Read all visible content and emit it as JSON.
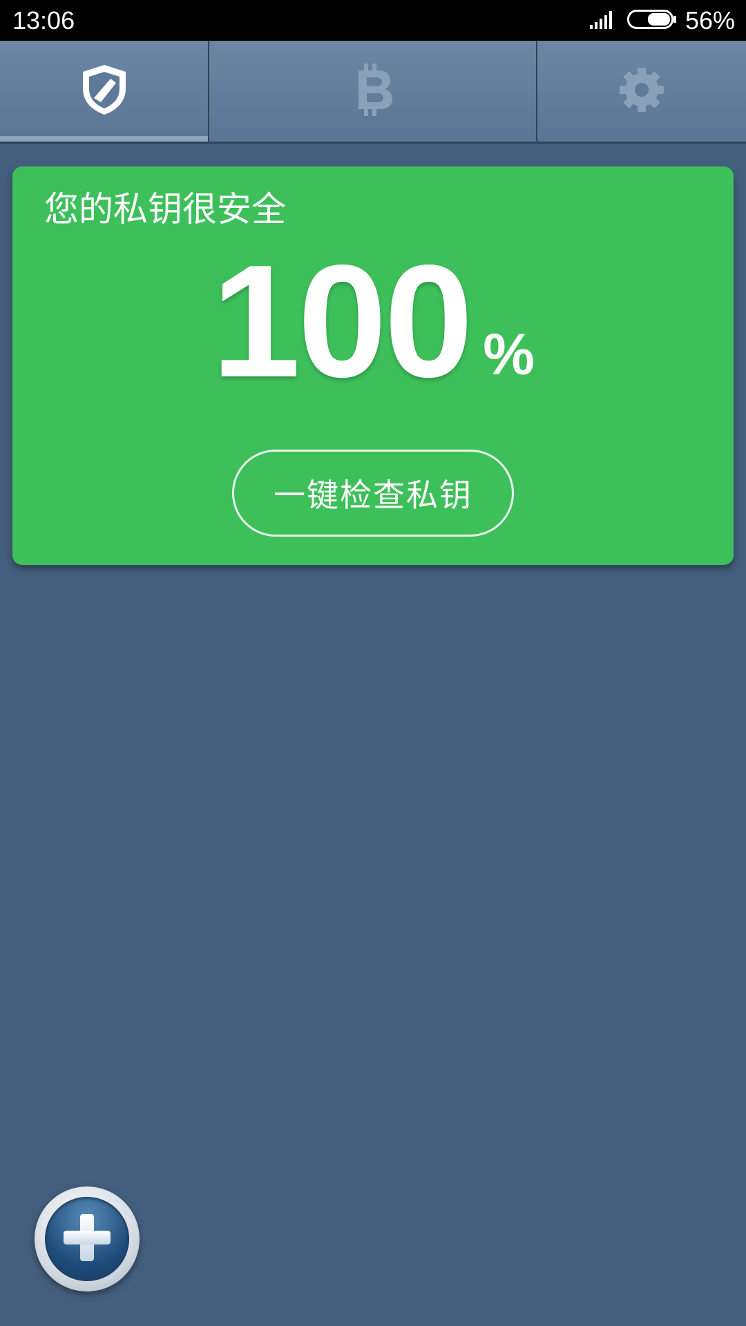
{
  "status_bar": {
    "time": "13:06",
    "battery_percent": "56%",
    "icons": [
      "signal-icon",
      "battery-icon"
    ]
  },
  "tabs": [
    {
      "name": "security",
      "icon": "shield-icon",
      "selected": true
    },
    {
      "name": "wallet",
      "icon": "bitcoin-icon",
      "selected": false
    },
    {
      "name": "settings",
      "icon": "gear-icon",
      "selected": false
    }
  ],
  "security_card": {
    "title": "您的私钥很安全",
    "score": "100",
    "score_unit": "%",
    "check_button_label": "一键检查私钥",
    "color": "#3dbf5a"
  },
  "add_button": {
    "icon": "plus-icon"
  },
  "colors": {
    "background": "#445f7d",
    "tab_bar": "#637e9c",
    "accent": "#3dbf5a"
  }
}
